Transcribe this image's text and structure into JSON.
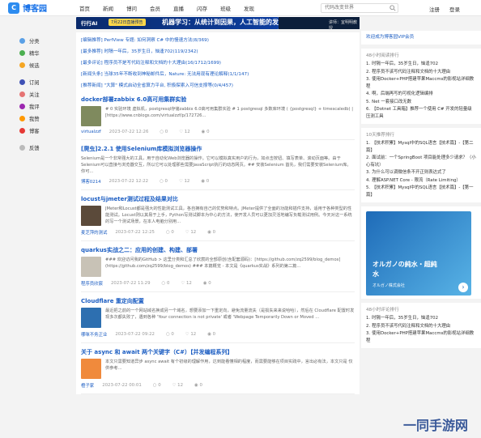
{
  "logo": {
    "text": "博客园"
  },
  "nav": [
    "首页",
    "新闻",
    "博问",
    "会员",
    "直播",
    "闪存",
    "班级",
    "发现"
  ],
  "nav_more_icon": "chevron-down-icon",
  "search": {
    "placeholder": "代码改变世界"
  },
  "top_right": [
    "注册",
    "登录"
  ],
  "left_menu": [
    {
      "label": "分类",
      "color": "#5aa0e6"
    },
    {
      "label": "精华",
      "color": "#4caf50"
    },
    {
      "label": "候选",
      "color": "#f5a623"
    },
    {
      "label": "订阅",
      "color": "#3f51b5"
    },
    {
      "label": "关注",
      "color": "#e57373"
    },
    {
      "label": "我评",
      "color": "#9c27b0"
    },
    {
      "label": "我赞",
      "color": "#ff9800"
    },
    {
      "label": "博客",
      "color": "#e53935"
    },
    {
      "label": "反馈",
      "color": "#bbbbbb"
    }
  ],
  "banner": {
    "logo": "行行AI",
    "tag": "7月22日直播预告",
    "title": "机器学习：从统计到因果，人工智能的发展之路",
    "sub": "讲师：宜明明教授"
  },
  "notices": [
    "[编辑推荐] PerfView 专题: 如何洞察 C# 中的慢速方法(8/369)",
    "[最多推荐] 时隔一年后，35岁生日，恼逢702(119/2342)",
    "[最多评论] 程序员不是写代码注释和文档的十大理由(16/1712/1699)",
    "[新闻头条] 当球35年不断收到神秘邮件后，Nature: 无法用现有理论解释(1/1/147)",
    "[推荐新闻] \"大算\" 模式启动全省算力平台, 积极探索入可信支撑等(0/4/457)"
  ],
  "posts": [
    {
      "title": "docker部署zabbix 6.0高可用集群实验",
      "summary": "# 0 实验环境 虚拟机，postgresql存储zabbix 6.0高可用集群实验  # 1 postgresql 多数库环境 ( {postgresql} + timescaledb) | [https://www.cnblogs.com/virtualzzf/p/172726...",
      "author": "virtualzzf",
      "date": "2023-07-22 12:26",
      "views": "0",
      "comments": "0",
      "likes": "12",
      "thumb_color": "#7f8a5e"
    },
    {
      "title": "[爬虫]2.2.1 使用Selenium库模拟浏览器操作",
      "summary": "Selenium是一个非常强大的工具，用于自动化Web浏览器的操作。它可以模拟真实用户的行为，如点击按钮、填写表单、滚动页面等。由于Selenium可以直接与浏览器交互，所以它可以处理那些需要JavaScript执行的动态网页。## 安装Selenium 首先，我们需要安装Selenium库。你可...",
      "author": "博客0214",
      "date": "2023-07-22 12:22",
      "views": "0",
      "comments": "0",
      "likes": "12",
      "thumb_color": ""
    },
    {
      "title": "locust与jmeter测试过程及结果对比",
      "summary": "JMeter和Locust都是强大的性能测试工具，各自拥有自己的优势和特点。JMeter提供了全面的功能和插件支持，适用于各种类型的性能测试。Locust则以其易于上手，Python写测试脚本为中心的方法，使开发人员可以更加灵活地编写负载测试用例。今天对这一系统的写一个测试场景，在本人电脑分别用...",
      "author": "麦芝萍的测试",
      "date": "2023-07-22 12:25",
      "views": "0",
      "comments": "0",
      "likes": "12",
      "thumb_color": "#5b4a3a"
    },
    {
      "title": "quarkus实战之二：应用的创建、构建、部署",
      "summary": "### 欢迎访问我的GitHub > 这里分类和汇总了欣宸的全部原创(含配套源码)：[https://github.com/zq2599/blog_demos](https://github.com/zq2599/blog_demos) ### 本篇概览 - 本文是《quarkus实战》系列的第二篇...",
      "author": "程序员欣宸",
      "date": "2023-07-22 11:29",
      "views": "0",
      "comments": "0",
      "likes": "12",
      "thumb_color": "#c8c2b6"
    },
    {
      "title": "Cloudflare 重定向配置",
      "summary": "最近把之前的一个网站域名换成另一个域名，想要添加一下重定向，避免流量流失（是损失来来说哈哈），然后在 Cloudflare 配置时发现多次都失败了，遇到各种 'Your connection is not private' 或者 'Webpage Temporarily Down or Moved ...",
      "author": "哪咪不务正业",
      "date": "2023-07-22 09:22",
      "views": "0",
      "comments": "0",
      "likes": "12",
      "thumb_color": "#2d6fb0"
    },
    {
      "title": "关于 async 和 await 两个关键字（C#）【并发编程系列】",
      "summary": "本文只需要知道异步 async await 有个初级的理解作用，达到能看懂相的程度，而需要能够在项目实践中，言出必有法，本文只是 仅供参考...",
      "author": "橙子家",
      "date": "2023-07-22 00:01",
      "views": "0",
      "comments": "0",
      "likes": "12",
      "thumb_color": "#f08a3c"
    }
  ],
  "right": {
    "vip_link": "欢迎成为博客园VIP会员",
    "h48_head": "48小时阅读排行",
    "h48_items": [
      "时隔一年后，35岁生日，恼逢702",
      "程序员不该写代码注释和文档的十大理由",
      "使用Docker+PHP搭建苹果Maccms的影视站详细教程",
      "啊，后端再写的可视化逻辑编排",
      "Net 一套接口改无数",
      "【Dotnet 工具箱】推荐一个使用 C# 开发的轻量级压测工具"
    ],
    "h10_head": "10天推荐排行",
    "h10_items": [
      "【技术积累】MysqI中的SQL语言【技术篇】-【第二篇】",
      "面试前：一个SpringBoot 项目能处理多少请求？（小心有坑）",
      "为什么可以调微信条不开正则表达式了",
      "理解ASP.NET Core - 限流（Rate Limiting）",
      "【技术积累】MysqI中的SQL语言【技术篇】-【第一篇】"
    ],
    "ad_line1": "オルガノの純水・超純",
    "ad_line2": "水",
    "ad_sub": "オルガノ株式会社",
    "h48b_head": "48小时评论排行",
    "h48b_items": [
      "时隔一年后，35岁生日，恼逢702",
      "程序员不该写代码注释和文档的十大理由",
      "使用Docker+PHP搭建苹果Maccms的影视站详细教程"
    ]
  },
  "watermark": "一同手游网"
}
